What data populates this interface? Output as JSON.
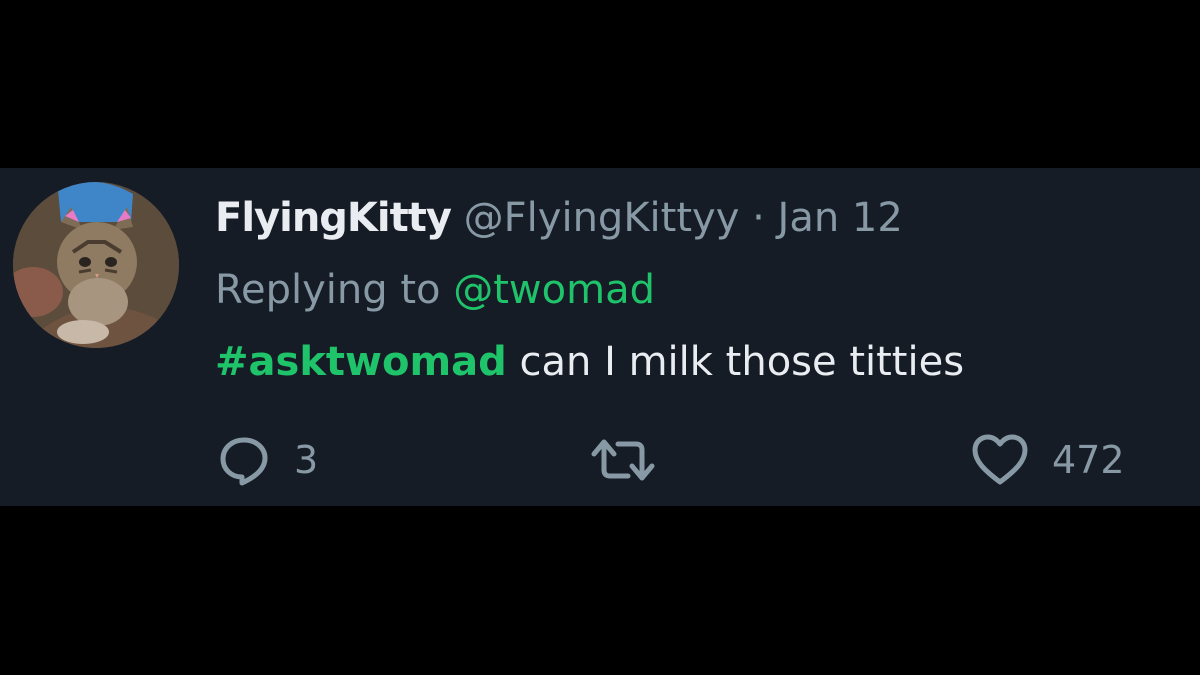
{
  "tweet": {
    "display_name": "FlyingKitty",
    "handle": "@FlyingKittyy",
    "separator": "·",
    "date": "Jan 12",
    "reply_prefix": "Replying to",
    "reply_to": "@twomad",
    "hashtag": "#asktwomad",
    "text": "can I milk those titties",
    "reply_count": "3",
    "like_count": "472"
  },
  "icons": {
    "reply": "reply-icon",
    "retweet": "retweet-icon",
    "like": "heart-icon",
    "avatar": "cat-avatar"
  },
  "colors": {
    "background": "#000000",
    "card": "#161c26",
    "primary_text": "#e9edf1",
    "secondary_text": "#8899a6",
    "accent": "#1fc46a"
  }
}
